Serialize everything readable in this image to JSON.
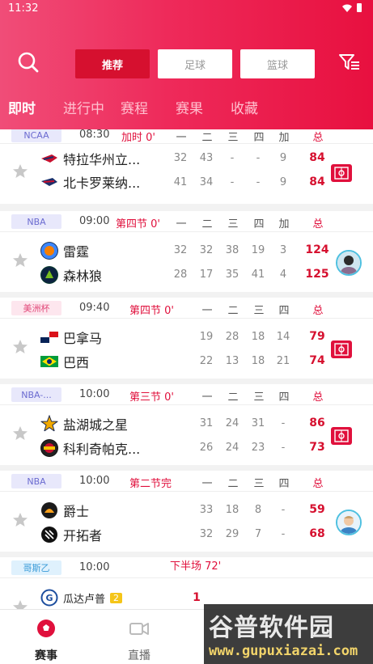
{
  "status_bar": {
    "time": "11:32"
  },
  "segments": [
    {
      "label": "推荐",
      "active": true
    },
    {
      "label": "足球",
      "active": false
    },
    {
      "label": "篮球",
      "active": false
    }
  ],
  "tabs": [
    {
      "label": "即时",
      "active": true
    },
    {
      "label": "进行中",
      "active": false
    },
    {
      "label": "赛程",
      "active": false
    },
    {
      "label": "赛果",
      "active": false
    },
    {
      "label": "收藏",
      "active": false
    }
  ],
  "matches": [
    {
      "league": "NCAA",
      "time": "08:30",
      "status": "加时 0'",
      "columns": [
        "一",
        "二",
        "三",
        "四",
        "加",
        "总"
      ],
      "home": {
        "name": "特拉华州立...",
        "scores": [
          "32",
          "43",
          "-",
          "-",
          "9"
        ],
        "total": "84"
      },
      "away": {
        "name": "北卡罗莱纳...",
        "scores": [
          "41",
          "34",
          "-",
          "-",
          "9"
        ],
        "total": "84"
      },
      "side": "live"
    },
    {
      "league": "NBA",
      "time": "09:00",
      "status": "第四节 0'",
      "columns": [
        "一",
        "二",
        "三",
        "四",
        "加",
        "总"
      ],
      "home": {
        "name": "雷霆",
        "scores": [
          "32",
          "32",
          "38",
          "19",
          "3"
        ],
        "total": "124"
      },
      "away": {
        "name": "森林狼",
        "scores": [
          "28",
          "17",
          "35",
          "41",
          "4"
        ],
        "total": "125"
      },
      "side": "avatar"
    },
    {
      "league": "美洲杯",
      "time": "09:40",
      "status": "第四节 0'",
      "columns": [
        "一",
        "二",
        "三",
        "四",
        "总"
      ],
      "home": {
        "name": "巴拿马",
        "scores": [
          "19",
          "28",
          "18",
          "14"
        ],
        "total": "79"
      },
      "away": {
        "name": "巴西",
        "scores": [
          "22",
          "13",
          "18",
          "21"
        ],
        "total": "74"
      },
      "side": "live"
    },
    {
      "league": "NBA-...",
      "time": "10:00",
      "status": "第三节 0'",
      "columns": [
        "一",
        "二",
        "三",
        "四",
        "总"
      ],
      "home": {
        "name": "盐湖城之星",
        "scores": [
          "31",
          "24",
          "31",
          "-"
        ],
        "total": "86"
      },
      "away": {
        "name": "科利奇帕克...",
        "scores": [
          "26",
          "24",
          "23",
          "-"
        ],
        "total": "73"
      },
      "side": "live"
    },
    {
      "league": "NBA",
      "time": "10:00",
      "status": "第二节完",
      "columns": [
        "一",
        "二",
        "三",
        "四",
        "总"
      ],
      "home": {
        "name": "爵士",
        "scores": [
          "33",
          "18",
          "8",
          "-"
        ],
        "total": "59"
      },
      "away": {
        "name": "开拓者",
        "scores": [
          "32",
          "29",
          "7",
          "-"
        ],
        "total": "68"
      },
      "side": "avatar"
    },
    {
      "league": "哥斯乙",
      "time": "10:00",
      "status": "下半场 72'",
      "home": {
        "name": "瓜达卢普",
        "badge": "2",
        "total": "1"
      }
    }
  ],
  "bottom_nav": [
    {
      "label": "赛事",
      "active": true
    },
    {
      "label": "直播",
      "active": false
    }
  ],
  "watermark": {
    "line1": "谷普软件园",
    "line2": "www.gupuxiazai.com"
  },
  "colors": {
    "accent": "#e0103c",
    "header_start": "#f04d78",
    "header_end": "#e8103f"
  }
}
